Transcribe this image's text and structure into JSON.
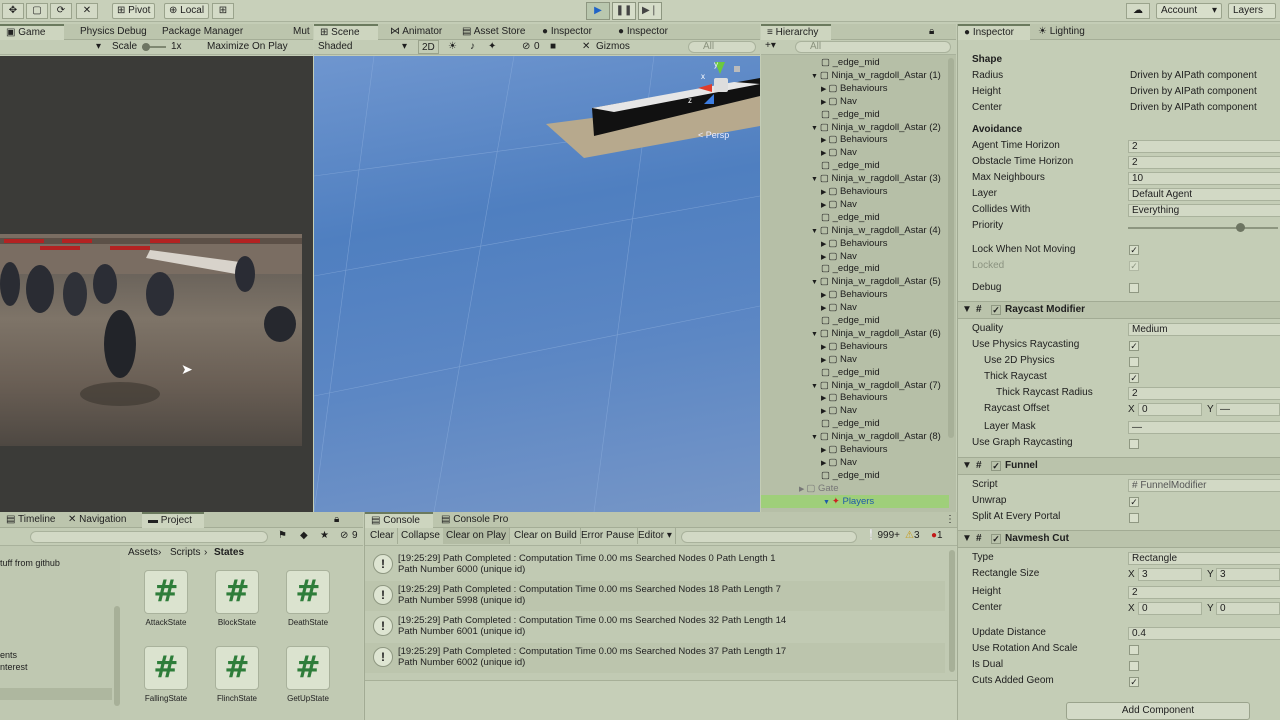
{
  "toolbar": {
    "pivot": "Pivot",
    "local": "Local",
    "account": "Account",
    "layers": "Layers"
  },
  "game_panel": {
    "tabs": [
      "Game",
      "Physics Debug",
      "Package Manager",
      "Mut"
    ],
    "scale_label": "Scale",
    "scale_value": "1x",
    "maximize": "Maximize On Play"
  },
  "scene_panel": {
    "tabs": [
      "Scene",
      "Animator",
      "Asset Store",
      "Inspector",
      "Inspector"
    ],
    "shading": "Shaded",
    "mode_2d": "2D",
    "hidden_count": "0",
    "gizmos": "Gizmos",
    "search_placeholder": "All",
    "persp": "< Persp",
    "axis_y": "y",
    "axis_z": "z",
    "axis_x": "x"
  },
  "hierarchy": {
    "title": "Hierarchy",
    "search_placeholder": "All",
    "rows": [
      {
        "label": "_edge_mid",
        "indent": 3,
        "type": "item"
      },
      {
        "label": "Ninja_w_ragdoll_Astar (1)",
        "indent": 1,
        "type": "obj"
      },
      {
        "label": "Behaviours",
        "indent": 2,
        "type": "child"
      },
      {
        "label": "Nav",
        "indent": 2,
        "type": "child"
      },
      {
        "label": "_edge_mid",
        "indent": 3,
        "type": "item"
      },
      {
        "label": "Ninja_w_ragdoll_Astar (2)",
        "indent": 1,
        "type": "obj"
      },
      {
        "label": "Behaviours",
        "indent": 2,
        "type": "child"
      },
      {
        "label": "Nav",
        "indent": 2,
        "type": "child"
      },
      {
        "label": "_edge_mid",
        "indent": 3,
        "type": "item"
      },
      {
        "label": "Ninja_w_ragdoll_Astar (3)",
        "indent": 1,
        "type": "obj"
      },
      {
        "label": "Behaviours",
        "indent": 2,
        "type": "child"
      },
      {
        "label": "Nav",
        "indent": 2,
        "type": "child"
      },
      {
        "label": "_edge_mid",
        "indent": 3,
        "type": "item"
      },
      {
        "label": "Ninja_w_ragdoll_Astar (4)",
        "indent": 1,
        "type": "obj"
      },
      {
        "label": "Behaviours",
        "indent": 2,
        "type": "child"
      },
      {
        "label": "Nav",
        "indent": 2,
        "type": "child"
      },
      {
        "label": "_edge_mid",
        "indent": 3,
        "type": "item"
      },
      {
        "label": "Ninja_w_ragdoll_Astar (5)",
        "indent": 1,
        "type": "obj"
      },
      {
        "label": "Behaviours",
        "indent": 2,
        "type": "child"
      },
      {
        "label": "Nav",
        "indent": 2,
        "type": "child"
      },
      {
        "label": "_edge_mid",
        "indent": 3,
        "type": "item"
      },
      {
        "label": "Ninja_w_ragdoll_Astar (6)",
        "indent": 1,
        "type": "obj"
      },
      {
        "label": "Behaviours",
        "indent": 2,
        "type": "child"
      },
      {
        "label": "Nav",
        "indent": 2,
        "type": "child"
      },
      {
        "label": "_edge_mid",
        "indent": 3,
        "type": "item"
      },
      {
        "label": "Ninja_w_ragdoll_Astar (7)",
        "indent": 1,
        "type": "obj"
      },
      {
        "label": "Behaviours",
        "indent": 2,
        "type": "child"
      },
      {
        "label": "Nav",
        "indent": 2,
        "type": "child"
      },
      {
        "label": "_edge_mid",
        "indent": 3,
        "type": "item"
      },
      {
        "label": "Ninja_w_ragdoll_Astar (8)",
        "indent": 1,
        "type": "obj"
      },
      {
        "label": "Behaviours",
        "indent": 2,
        "type": "child"
      },
      {
        "label": "Nav",
        "indent": 2,
        "type": "child"
      },
      {
        "label": "_edge_mid",
        "indent": 3,
        "type": "item"
      },
      {
        "label": "Gate",
        "indent": 0,
        "type": "root"
      },
      {
        "label": "Players",
        "indent": 0,
        "type": "root"
      }
    ]
  },
  "inspector": {
    "tabs": [
      "Inspector",
      "Lighting"
    ],
    "shape_header": "Shape",
    "radius_label": "Radius",
    "radius_value": "Driven by AIPath component",
    "height_label": "Height",
    "height_value": "Driven by AIPath component",
    "center_label": "Center",
    "center_value": "Driven by AIPath component",
    "avoidance_header": "Avoidance",
    "agent_time_label": "Agent Time Horizon",
    "agent_time_value": "2",
    "obstacle_time_label": "Obstacle Time Horizon",
    "obstacle_time_value": "2",
    "max_neighbours_label": "Max Neighbours",
    "max_neighbours_value": "10",
    "layer_label": "Layer",
    "layer_value": "Default Agent",
    "collides_label": "Collides With",
    "collides_value": "Everything",
    "priority_label": "Priority",
    "priority_level": 0.75,
    "lock_label": "Lock When Not Moving",
    "locked_label": "Locked",
    "debug_label": "Debug",
    "raycast": {
      "title": "Raycast Modifier",
      "quality_label": "Quality",
      "quality_value": "Medium",
      "use_physics_label": "Use Physics Raycasting",
      "use_2d_label": "Use 2D Physics",
      "thick_label": "Thick Raycast",
      "thick_radius_label": "Thick Raycast Radius",
      "thick_radius_value": "2",
      "offset_label": "Raycast Offset",
      "offset_x_label": "X",
      "offset_x": "0",
      "offset_y_label": "Y",
      "offset_y": "—",
      "layer_mask_label": "Layer Mask",
      "layer_mask_value": "—",
      "graph_label": "Use Graph Raycasting"
    },
    "funnel": {
      "title": "Funnel",
      "script_label": "Script",
      "script_value": "FunnelModifier",
      "unwrap_label": "Unwrap",
      "split_label": "Split At Every Portal"
    },
    "navmesh": {
      "title": "Navmesh Cut",
      "type_label": "Type",
      "type_value": "Rectangle",
      "rect_size_label": "Rectangle Size",
      "rect_x_label": "X",
      "rect_x": "3",
      "rect_y_label": "Y",
      "rect_y": "3",
      "height_label": "Height",
      "height_value": "2",
      "center_label": "Center",
      "center_x_label": "X",
      "center_x": "0",
      "center_y_label": "Y",
      "center_y": "0",
      "update_dist_label": "Update Distance",
      "update_dist_value": "0.4",
      "use_rot_label": "Use Rotation And Scale",
      "is_dual_label": "Is Dual",
      "cuts_geom_label": "Cuts Added Geom"
    },
    "add_component": "Add Component"
  },
  "project": {
    "tabs": [
      "Timeline",
      "Navigation",
      "Project"
    ],
    "badge_count": "9",
    "breadcrumb": [
      "Assets",
      "Scripts",
      "States"
    ],
    "left_items": [
      "tuff from github",
      "ents",
      "nterest"
    ],
    "assets": [
      "AttackState",
      "BlockState",
      "DeathState",
      "FallingState",
      "FlinchState",
      "GetUpState"
    ]
  },
  "console": {
    "tabs": [
      "Console",
      "Console Pro"
    ],
    "buttons": [
      "Clear",
      "Collapse",
      "Clear on Play",
      "Clear on Build",
      "Error Pause",
      "Editor"
    ],
    "log_count": "999+",
    "warn_count": "3",
    "error_count": "1",
    "entries": [
      {
        "line1": "[19:25:29] Path Completed : Computation Time 0.00 ms Searched Nodes 0 Path Length 1",
        "line2": "Path Number 6000 (unique id)"
      },
      {
        "line1": "[19:25:29] Path Completed : Computation Time 0.00 ms Searched Nodes 18 Path Length 7",
        "line2": "Path Number 5998 (unique id)"
      },
      {
        "line1": "[19:25:29] Path Completed : Computation Time 0.00 ms Searched Nodes 32 Path Length 14",
        "line2": "Path Number 6001 (unique id)"
      },
      {
        "line1": "[19:25:29] Path Completed : Computation Time 0.00 ms Searched Nodes 37 Path Length 17",
        "line2": "Path Number 6002 (unique id)"
      }
    ]
  }
}
